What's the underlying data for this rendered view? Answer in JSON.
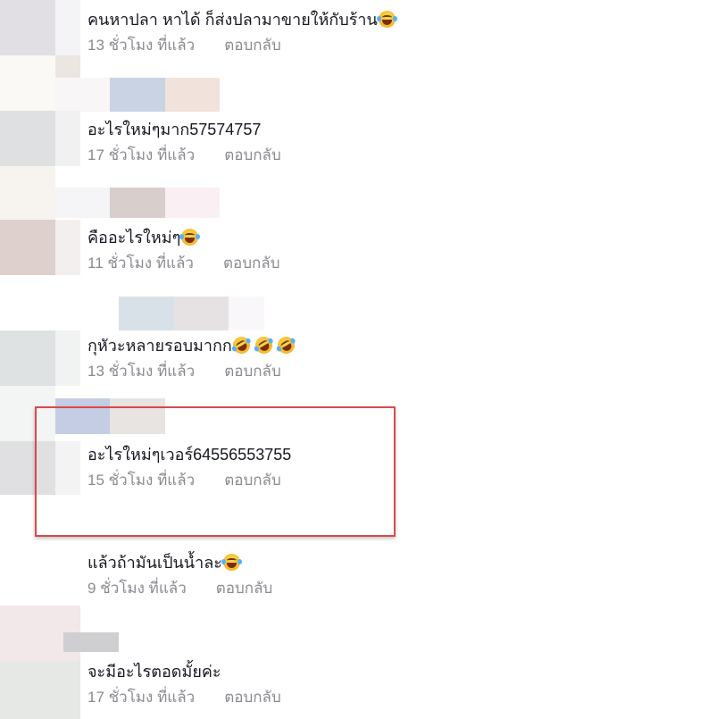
{
  "comments": [
    {
      "text": "คนหาปลา หาได้ ก็ส่งปลามาขายให้กับร้าน",
      "emojis": [
        "joy"
      ],
      "time": "13 ชั่วโมง ที่แล้ว",
      "reply": "ตอบกลับ"
    },
    {
      "text": "อะไรใหม่ๆมาก57574757",
      "emojis": [],
      "time": "17 ชั่วโมง ที่แล้ว",
      "reply": "ตอบกลับ"
    },
    {
      "text": "คืออะไรใหม่ๆ",
      "emojis": [
        "joy"
      ],
      "time": "11 ชั่วโมง ที่แล้ว",
      "reply": "ตอบกลับ"
    },
    {
      "text": "กุหัวะหลายรอบมากก",
      "emojis": [
        "rofl",
        "rofl",
        "rofl"
      ],
      "time": "13 ชั่วโมง ที่แล้ว",
      "reply": "ตอบกลับ"
    },
    {
      "text": "อะไรใหม่ๆเวอร์64556553755",
      "emojis": [],
      "time": "15 ชั่วโมง ที่แล้ว",
      "reply": "ตอบกลับ"
    },
    {
      "text": "แล้วถ้ามันเป็นน้ำละ",
      "emojis": [
        "joy"
      ],
      "time": "9 ชั่วโมง ที่แล้ว",
      "reply": "ตอบกลับ"
    },
    {
      "text": "จะมีอะไรตอดมั้ยค่ะ",
      "emojis": [],
      "time": "17 ชั่วโมง ที่แล้ว",
      "reply": "ตอบกลับ"
    }
  ],
  "icons": {
    "joy": "face-with-tears-of-joy-icon",
    "rofl": "rolling-on-floor-laughing-icon"
  },
  "colors": {
    "text": "#161823",
    "meta": "#8a8b91",
    "highlight": "#d94a4a"
  }
}
